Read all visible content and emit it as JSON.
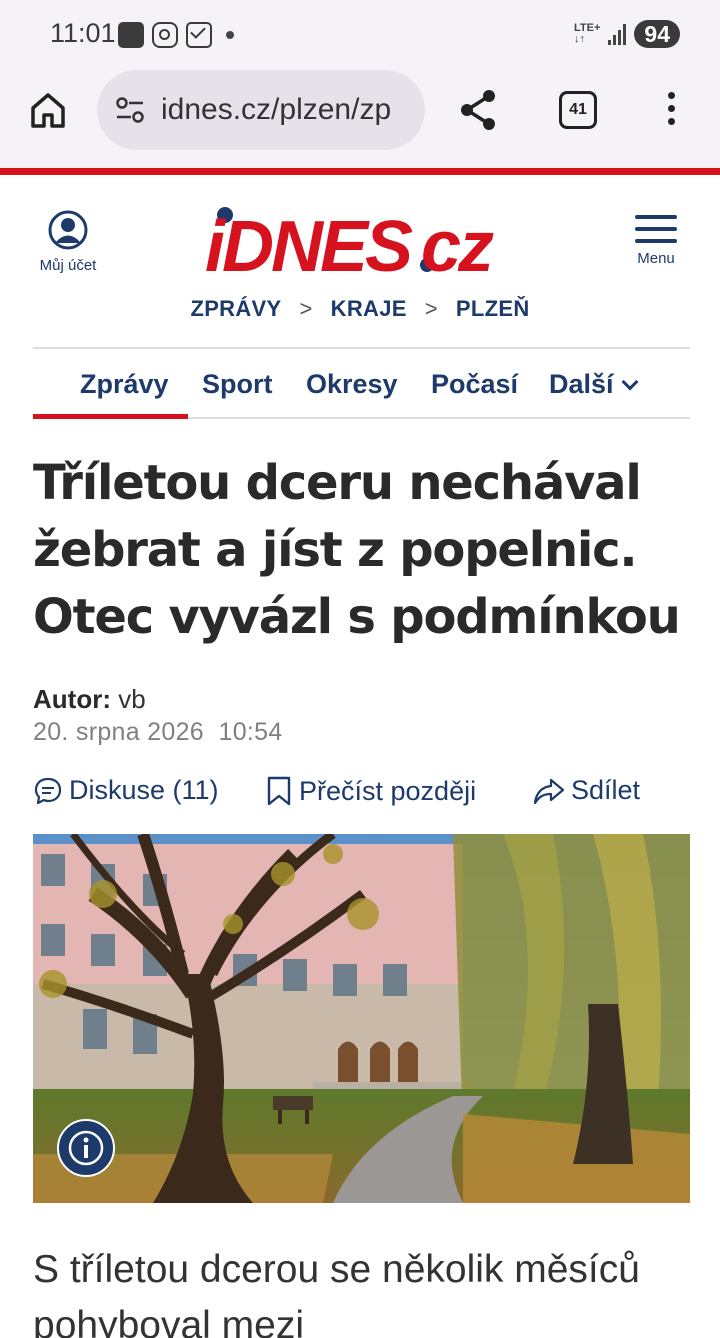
{
  "status_bar": {
    "time": "11:01",
    "network": "LTE+",
    "battery": "94"
  },
  "browser": {
    "url": "idnes.cz/plzen/zp",
    "tab_count": "41"
  },
  "site": {
    "account_label": "Můj účet",
    "logo_text_main": "iDNES",
    "logo_text_tld": ".cz",
    "menu_label": "Menu",
    "brand_color": "#d5121e",
    "nav_color": "#1d3a6b"
  },
  "breadcrumb": [
    "ZPRÁVY",
    "KRAJE",
    "PLZEŇ"
  ],
  "nav": {
    "items": [
      "Zprávy",
      "Sport",
      "Okresy",
      "Počasí",
      "Další"
    ],
    "active_index": 0
  },
  "article": {
    "headline": "Tříletou dceru nechával žebrat a jíst z popelnic. Otec vyvázl s podmínkou",
    "author_label": "Autor:",
    "author": "vb",
    "date": "20. srpna 2026",
    "time": "10:54",
    "actions": {
      "discussion": "Diskuse (11)",
      "read_later": "Přečíst později",
      "share": "Sdílet"
    },
    "lead": "S tříletou dcerou se několik měsíců pohyboval mezi"
  },
  "icons": {
    "home": "home-icon",
    "site_settings": "tune-icon",
    "share": "share-icon",
    "more": "more-vert-icon",
    "info": "info-icon"
  }
}
